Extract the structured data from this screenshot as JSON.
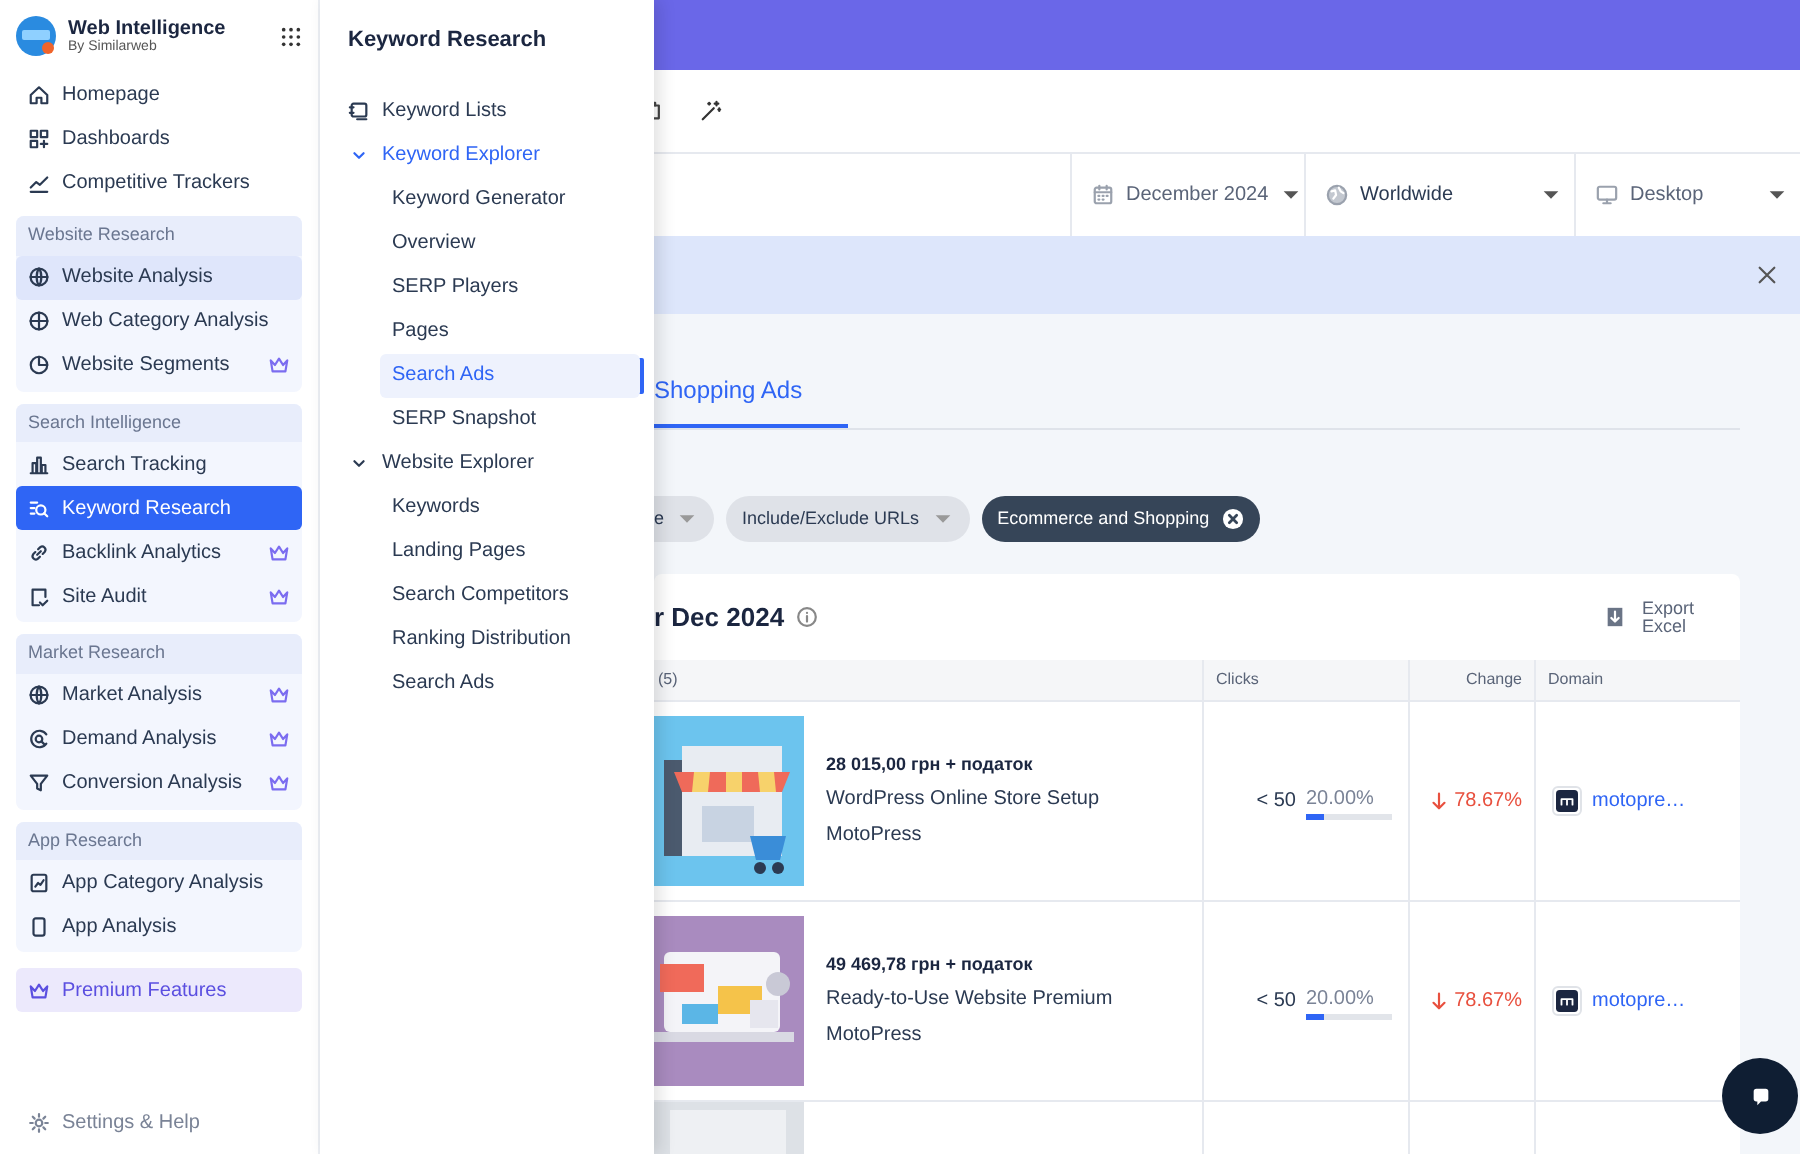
{
  "sidebar": {
    "brand": {
      "title": "Web Intelligence",
      "subtitle": "By Similarweb"
    },
    "top_items": [
      {
        "label": "Homepage"
      },
      {
        "label": "Dashboards"
      },
      {
        "label": "Competitive Trackers"
      }
    ],
    "groups": [
      {
        "heading": "Website Research",
        "items": [
          {
            "label": "Website Analysis",
            "premium": false,
            "selected": false,
            "highlighted": true
          },
          {
            "label": "Web Category Analysis",
            "premium": false,
            "selected": false,
            "highlighted": false
          },
          {
            "label": "Website Segments",
            "premium": true,
            "selected": false,
            "highlighted": false
          }
        ]
      },
      {
        "heading": "Search Intelligence",
        "items": [
          {
            "label": "Search Tracking",
            "premium": false,
            "selected": false,
            "highlighted": false
          },
          {
            "label": "Keyword Research",
            "premium": false,
            "selected": true,
            "highlighted": false
          },
          {
            "label": "Backlink Analytics",
            "premium": true,
            "selected": false,
            "highlighted": false
          },
          {
            "label": "Site Audit",
            "premium": true,
            "selected": false,
            "highlighted": false
          }
        ]
      },
      {
        "heading": "Market Research",
        "items": [
          {
            "label": "Market Analysis",
            "premium": true,
            "selected": false,
            "highlighted": false
          },
          {
            "label": "Demand Analysis",
            "premium": true,
            "selected": false,
            "highlighted": false
          },
          {
            "label": "Conversion Analysis",
            "premium": true,
            "selected": false,
            "highlighted": false
          }
        ]
      },
      {
        "heading": "App Research",
        "items": [
          {
            "label": "App Category Analysis",
            "premium": false,
            "selected": false,
            "highlighted": false
          },
          {
            "label": "App Analysis",
            "premium": false,
            "selected": false,
            "highlighted": false
          }
        ]
      }
    ],
    "premium_link": {
      "label": "Premium Features"
    },
    "settings": {
      "label": "Settings & Help"
    }
  },
  "panel": {
    "title": "Keyword Research",
    "items": [
      {
        "label": "Keyword Lists",
        "kind": "link"
      },
      {
        "label": "Keyword Explorer",
        "kind": "folder",
        "expanded": true,
        "active": true,
        "children": [
          {
            "label": "Keyword Generator",
            "selected": false
          },
          {
            "label": "Overview",
            "selected": false
          },
          {
            "label": "SERP Players",
            "selected": false
          },
          {
            "label": "Pages",
            "selected": false
          },
          {
            "label": "Search Ads",
            "selected": true
          },
          {
            "label": "SERP Snapshot",
            "selected": false
          }
        ]
      },
      {
        "label": "Website Explorer",
        "kind": "folder",
        "expanded": true,
        "active": false,
        "children": [
          {
            "label": "Keywords",
            "selected": false
          },
          {
            "label": "Landing Pages",
            "selected": false
          },
          {
            "label": "Search Competitors",
            "selected": false
          },
          {
            "label": "Ranking Distribution",
            "selected": false
          },
          {
            "label": "Search Ads",
            "selected": false
          }
        ]
      }
    ]
  },
  "filters": [
    {
      "label": "December 2024",
      "kind": "date"
    },
    {
      "label": "Worldwide",
      "kind": "country"
    },
    {
      "label": "Desktop",
      "kind": "device"
    }
  ],
  "tabs": [
    {
      "label": "Shopping Ads",
      "selected": true
    }
  ],
  "chips": [
    {
      "label": "e",
      "active": false
    },
    {
      "label": "Include/Exclude URLs",
      "active": false
    },
    {
      "label": "Ecommerce and Shopping",
      "active": true
    }
  ],
  "card": {
    "title": "r Dec 2024",
    "export": "Export Excel"
  },
  "table": {
    "columns": [
      "(5)",
      "Clicks",
      "Change",
      "Domain"
    ],
    "rows": [
      {
        "price": "28 015,00 грн + податок",
        "title": "WordPress Online Store Setup",
        "advertiser": "MotoPress",
        "clicks": "< 50",
        "share": "20.00%",
        "level": 0.2,
        "change": "78.67%",
        "domain": "motopre…"
      },
      {
        "price": "49 469,78 грн + податок",
        "title": "Ready-to-Use Website Premium",
        "advertiser": "MotoPress",
        "clicks": "< 50",
        "share": "20.00%",
        "level": 0.2,
        "change": "78.67%",
        "domain": "motopre…"
      },
      {
        "kind": "picture"
      }
    ]
  }
}
